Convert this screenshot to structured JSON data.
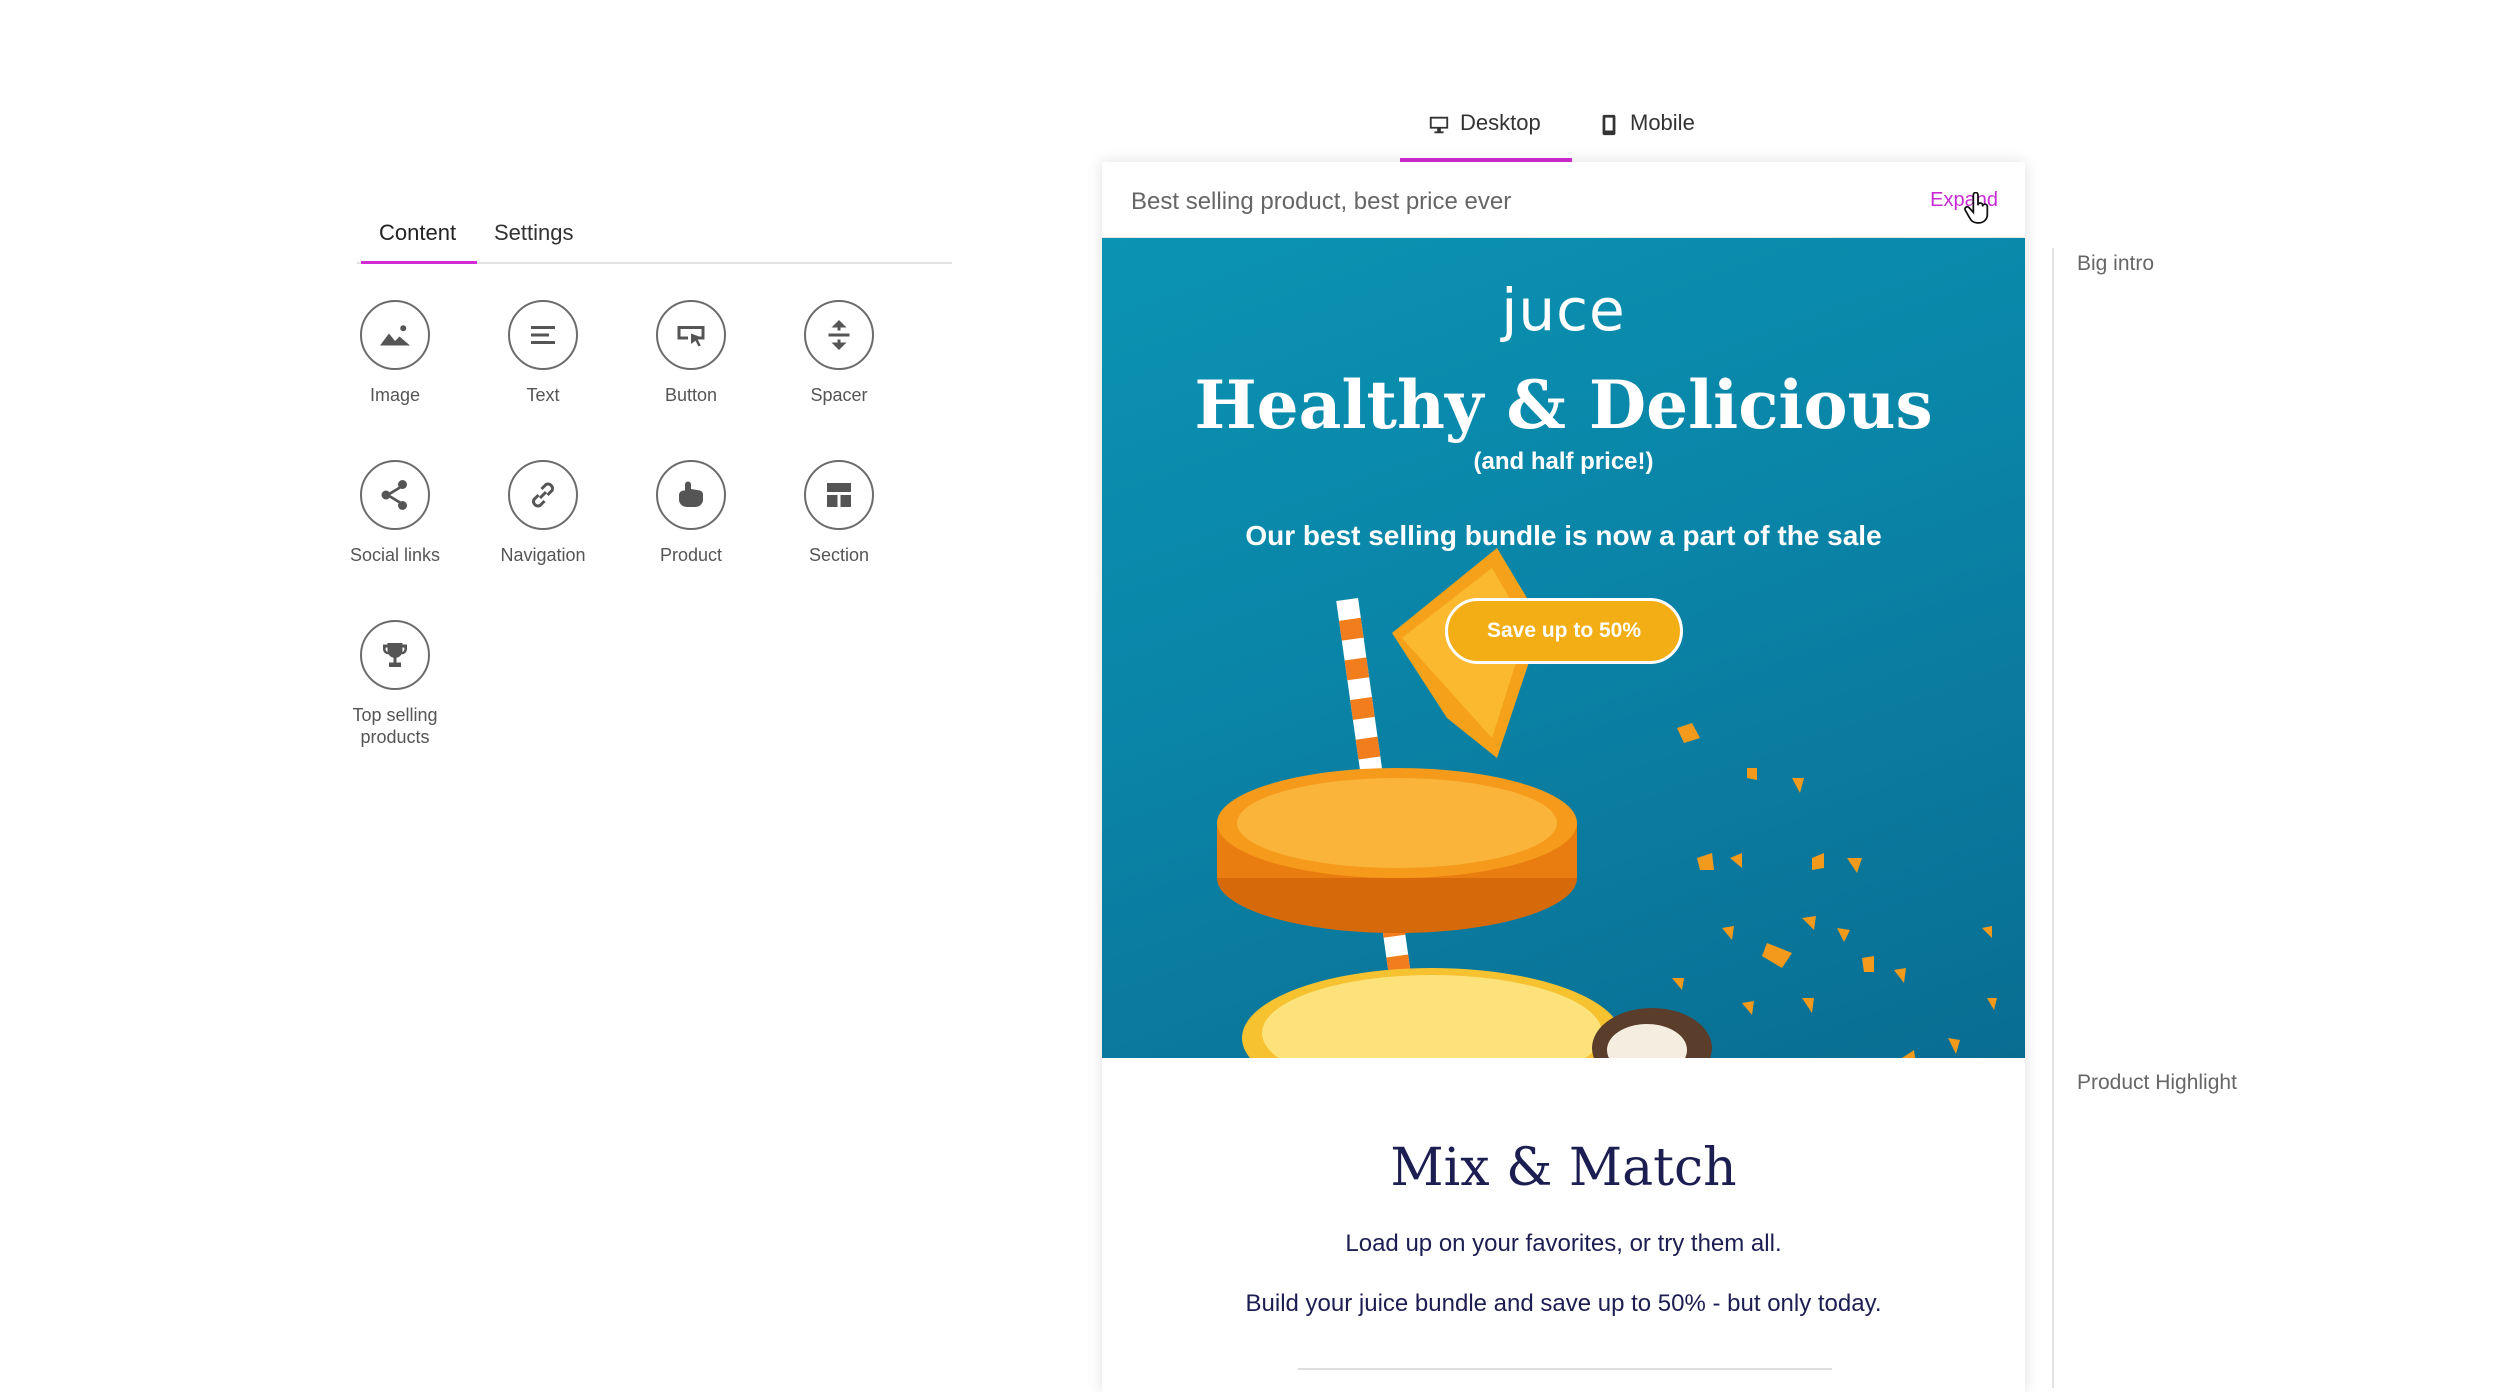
{
  "left_panel": {
    "tabs": [
      {
        "label": "Content",
        "active": true
      },
      {
        "label": "Settings",
        "active": false
      }
    ],
    "blocks": [
      {
        "label": "Image",
        "icon": "image-icon"
      },
      {
        "label": "Text",
        "icon": "text-icon"
      },
      {
        "label": "Button",
        "icon": "button-icon"
      },
      {
        "label": "Spacer",
        "icon": "spacer-icon"
      },
      {
        "label": "Social links",
        "icon": "share-icon"
      },
      {
        "label": "Navigation",
        "icon": "link-icon"
      },
      {
        "label": "Product",
        "icon": "product-icon"
      },
      {
        "label": "Section",
        "icon": "section-icon"
      },
      {
        "label": "Top selling products",
        "icon": "trophy-icon"
      }
    ]
  },
  "device_tabs": [
    {
      "label": "Desktop",
      "icon": "desktop-icon",
      "active": true
    },
    {
      "label": "Mobile",
      "icon": "mobile-icon",
      "active": false
    }
  ],
  "email": {
    "subject": "Best selling product, best price ever",
    "expand_label": "Expand",
    "hero": {
      "logo": "juce",
      "title": "Healthy & Delicious",
      "subtitle": "(and half price!)",
      "tagline": "Our best selling bundle is now a part of the sale",
      "cta": "Save up to 50%"
    },
    "product_highlight": {
      "title": "Mix & Match",
      "line1": "Load up on your favorites, or try them all.",
      "line2": "Build your juice bundle and save up to 50% - but only today."
    }
  },
  "outline": {
    "sections": [
      "Big intro",
      "Product Highlight"
    ]
  },
  "colors": {
    "accent": "#d22bd6",
    "hero_bg": "#0a84a7",
    "cta_bg": "#f3ad15",
    "headline_dark": "#1c1e52"
  }
}
